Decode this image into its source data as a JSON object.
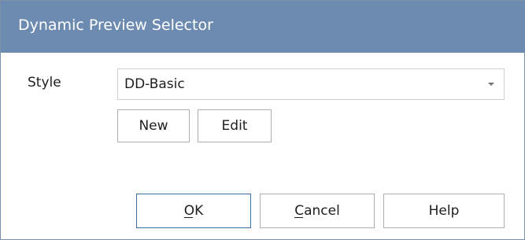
{
  "dialog": {
    "title": "Dynamic Preview Selector"
  },
  "style_field": {
    "label": "Style",
    "selected": "DD-Basic",
    "arrow_icon": "chevron-down-icon"
  },
  "actions": {
    "new_label": "New",
    "edit_label": "Edit"
  },
  "footer": {
    "ok_label": "OK",
    "cancel_label": "Cancel",
    "help_label": "Help"
  },
  "colors": {
    "titlebar": "#6d8bb1",
    "default_button_border": "#3b6ea5"
  }
}
